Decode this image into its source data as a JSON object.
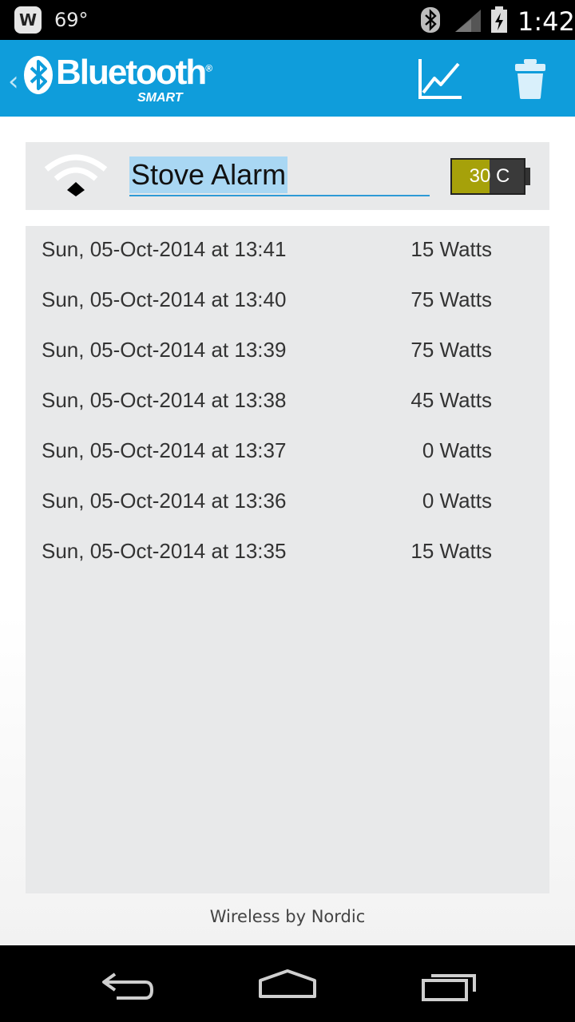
{
  "status_bar": {
    "weather_badge": "W",
    "temperature": "69°",
    "time": "1:42"
  },
  "app_bar": {
    "back_chevron": "‹",
    "brand": "Bluetooth",
    "brand_reg": "®",
    "brand_sub": "SMART",
    "accent_color": "#0f9ddb"
  },
  "device": {
    "name": "Stove Alarm",
    "temperature_label": "30 C",
    "temperature_fill": 0.52,
    "gauge_color": "#a6a10a"
  },
  "readings": [
    {
      "date": "Sun, 05-Oct-2014 at 13:41",
      "watts": "15 Watts"
    },
    {
      "date": "Sun, 05-Oct-2014 at 13:40",
      "watts": "75 Watts"
    },
    {
      "date": "Sun, 05-Oct-2014 at 13:39",
      "watts": "75 Watts"
    },
    {
      "date": "Sun, 05-Oct-2014 at 13:38",
      "watts": "45 Watts"
    },
    {
      "date": "Sun, 05-Oct-2014 at 13:37",
      "watts": "0 Watts"
    },
    {
      "date": "Sun, 05-Oct-2014 at 13:36",
      "watts": "0 Watts"
    },
    {
      "date": "Sun, 05-Oct-2014 at 13:35",
      "watts": "15 Watts"
    }
  ],
  "footer": "Wireless by Nordic",
  "icons": [
    "bluetooth-icon",
    "signal-icon",
    "battery-icon",
    "graph-icon",
    "trash-icon",
    "wifi-icon",
    "back-nav-icon",
    "home-nav-icon",
    "recents-nav-icon"
  ]
}
